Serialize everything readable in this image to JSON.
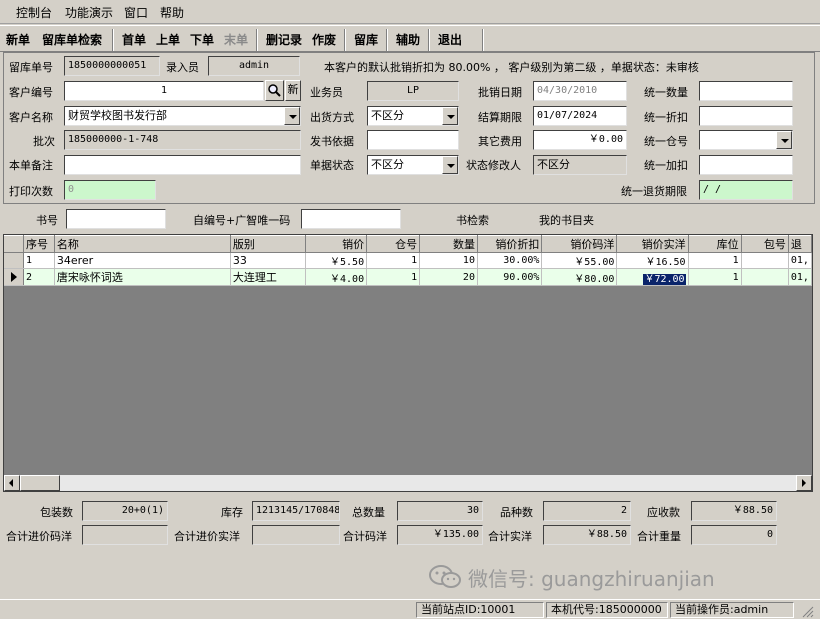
{
  "menu": [
    "控制台",
    "功能演示",
    "窗口",
    "帮助"
  ],
  "toolbar": {
    "new": "新单",
    "search": "留库单检索",
    "first": "首单",
    "prev": "上单",
    "next": "下单",
    "last": "末单",
    "delete_record": "删记录",
    "void": "作废",
    "stock": "留库",
    "assist": "辅助",
    "exit": "退出"
  },
  "form": {
    "order_no_label": "留库单号",
    "order_no": "1850000000051",
    "entered_by_label": "录入员",
    "entered_by": "admin",
    "info_text": "本客户的默认批销折扣为 80.00% ， 客户级别为第二级 ，单据状态：未审核",
    "customer_no_label": "客户编号",
    "customer_no": "1",
    "new_btn": "新",
    "salesman_label": "业务员",
    "salesman": "LP",
    "wholesale_date_label": "批销日期",
    "wholesale_date": "04/30/2010",
    "unified_qty_label": "统一数量",
    "customer_name_label": "客户名称",
    "customer_name": "财贸学校图书发行部",
    "ship_method_label": "出货方式",
    "ship_method": "不区分",
    "settle_label": "结算期限",
    "settle_date": "01/07/2024",
    "unified_discount_label": "统一折扣",
    "batch_label": "批次",
    "batch": "185000000-1-748",
    "issue_basis_label": "发书依据",
    "other_fee_label": "其它费用",
    "other_fee": "￥0.00",
    "unified_warehouse_label": "统一仓号",
    "remarks_label": "本单备注",
    "doc_status_label": "单据状态",
    "doc_status": "不区分",
    "status_modifier_label": "状态修改人",
    "status_modifier": "不区分",
    "unified_extra_label": "统一加扣",
    "print_count_label": "打印次数",
    "print_count": "0",
    "return_period_label": "统一退货期限",
    "return_period": " /  /"
  },
  "search_row": {
    "book_no_label": "书号",
    "self_code_label": "自编号+广智唯一码",
    "book_search": "书检索",
    "my_folder": "我的书目夹"
  },
  "grid": {
    "columns": [
      "序号",
      "名称",
      "版别",
      "销价",
      "仓号",
      "数量",
      "销价折扣",
      "销价码洋",
      "销价实洋",
      "库位",
      "包号",
      "退"
    ],
    "rows": [
      [
        "1",
        "34erer",
        "33",
        "￥5.50",
        "1",
        "10",
        "30.00%",
        "￥55.00",
        "￥16.50",
        "1",
        "",
        "01,"
      ],
      [
        "2",
        "唐宋咏怀词选",
        "大连理工",
        "￥4.00",
        "1",
        "20",
        "90.00%",
        "￥80.00",
        "￥72.00",
        "1",
        "",
        "01,"
      ]
    ]
  },
  "totals": {
    "package_label": "包装数",
    "package": "20+0(1)",
    "stock_label": "库存",
    "stock": "1213145/170848",
    "total_qty_label": "总数量",
    "total_qty": "30",
    "varieties_label": "品种数",
    "varieties": "2",
    "receivable_label": "应收款",
    "receivable": "￥88.50",
    "cost_list_label": "合计进价码洋",
    "cost_list": "",
    "cost_real_label": "合计进价实洋",
    "cost_real": "",
    "list_total_label": "合计码洋",
    "list_total": "￥135.00",
    "real_total_label": "合计实洋",
    "real_total": "￥88.50",
    "weight_label": "合计重量",
    "weight": "0"
  },
  "status": {
    "site": "当前站点ID:10001",
    "machine": "本机代号:185000000",
    "operator": "当前操作员:admin"
  },
  "watermark": "微信号: guangzhiruanjian",
  "colors": {
    "window_bg": "#d4d0c8",
    "highlight_green": "#ccf7cc",
    "selection_blue": "#0a246a"
  }
}
